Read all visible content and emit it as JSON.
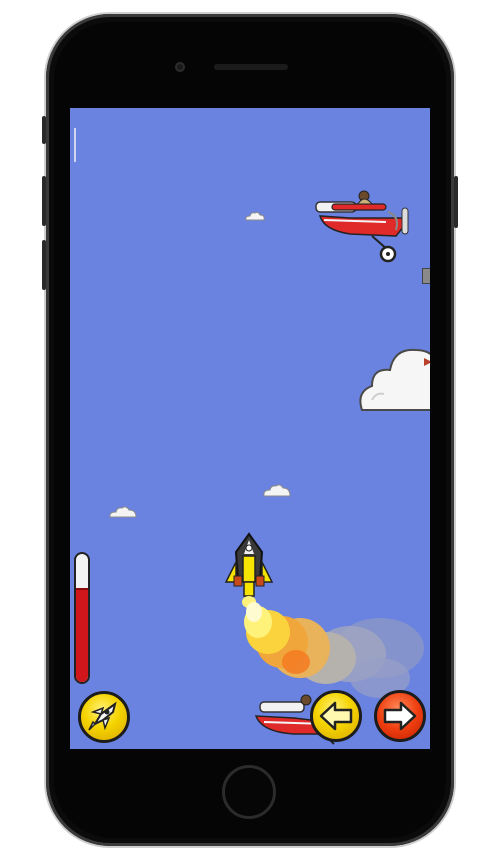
{
  "game": {
    "fuel_level": 0.72,
    "colors": {
      "sky": "#6a83e0",
      "fuel": "#d0161a",
      "boost_button": "#f5d400",
      "left_button": "#f5d400",
      "right_button": "#ef3f10"
    },
    "controls": {
      "boost_icon": "rocket-boost-icon",
      "left_icon": "arrow-left-icon",
      "right_icon": "arrow-right-icon"
    },
    "sprites": [
      "biplane-enemy",
      "player-rocket",
      "exhaust-smoke",
      "cloud"
    ]
  }
}
